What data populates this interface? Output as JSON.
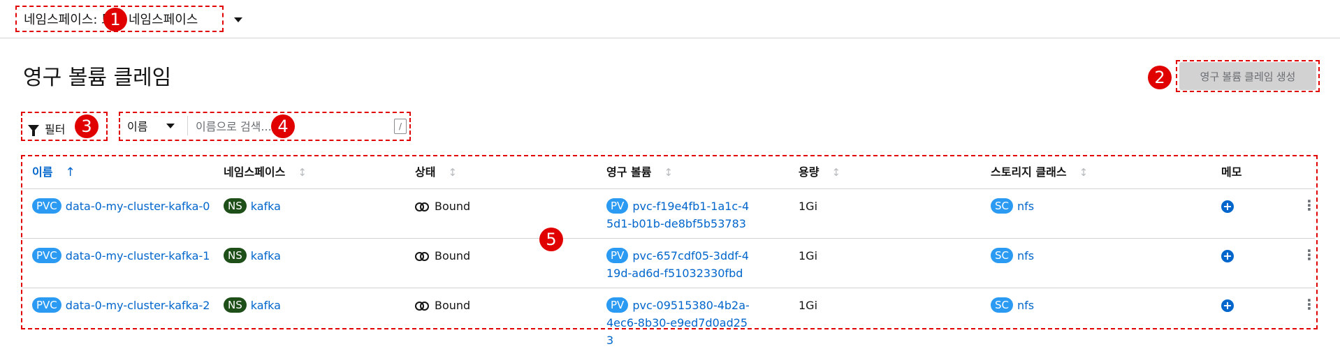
{
  "topbar": {
    "namespace_label": "네임스페이스: 모든 네임스페이스"
  },
  "page": {
    "title": "영구 볼륨 클레임"
  },
  "actions": {
    "create_label": "영구 볼륨 클레임 생성"
  },
  "toolbar": {
    "filter_label": "필터",
    "search_attribute": "이름",
    "search_placeholder": "이름으로 검색...",
    "shortcut_key": "/"
  },
  "table": {
    "columns": [
      "이름",
      "네임스페이스",
      "상태",
      "영구 볼륨",
      "용량",
      "스토리지 클래스",
      "메모"
    ],
    "sorted_column": "이름",
    "rows": [
      {
        "name_badge": "PVC",
        "name": "data-0-my-cluster-kafka-0",
        "ns_badge": "NS",
        "namespace": "kafka",
        "status": "Bound",
        "pv_badge": "PV",
        "volume": "pvc-f19e4fb1-1a1c-45d1-b01b-de8bf5b53783",
        "capacity": "1Gi",
        "sc_badge": "SC",
        "storage_class": "nfs"
      },
      {
        "name_badge": "PVC",
        "name": "data-0-my-cluster-kafka-1",
        "ns_badge": "NS",
        "namespace": "kafka",
        "status": "Bound",
        "pv_badge": "PV",
        "volume": "pvc-657cdf05-3ddf-419d-ad6d-f51032330fbd",
        "capacity": "1Gi",
        "sc_badge": "SC",
        "storage_class": "nfs"
      },
      {
        "name_badge": "PVC",
        "name": "data-0-my-cluster-kafka-2",
        "ns_badge": "NS",
        "namespace": "kafka",
        "status": "Bound",
        "pv_badge": "PV",
        "volume": "pvc-09515380-4b2a-4ec6-8b30-e9ed7d0ad253",
        "capacity": "1Gi",
        "sc_badge": "SC",
        "storage_class": "nfs"
      }
    ]
  },
  "annotations": {
    "markers": [
      "1",
      "2",
      "3",
      "4",
      "5"
    ]
  }
}
